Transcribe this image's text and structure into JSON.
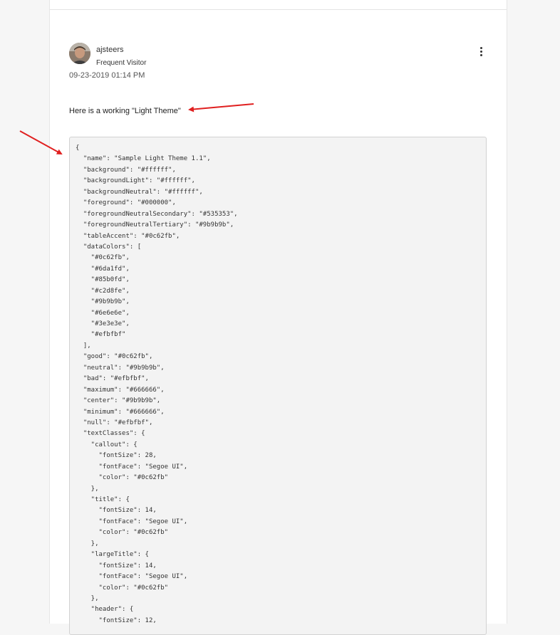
{
  "post": {
    "author": "ajsteers",
    "rank": "Frequent Visitor",
    "date": "09-23-2019 01:14 PM",
    "body_text": "Here is a working \"Light Theme\"",
    "menu_icon": "more-vertical-icon",
    "avatar_icon": "user-photo"
  },
  "annotation_color": "#e02020",
  "code_lines": [
    "{",
    "  \"name\": \"Sample Light Theme 1.1\",",
    "  \"background\": \"#ffffff\",",
    "  \"backgroundLight\": \"#ffffff\",",
    "  \"backgroundNeutral\": \"#ffffff\",",
    "  \"foreground\": \"#000000\",",
    "  \"foregroundNeutralSecondary\": \"#535353\",",
    "  \"foregroundNeutralTertiary\": \"#9b9b9b\",",
    "  \"tableAccent\": \"#0c62fb\",",
    "  \"dataColors\": [",
    "    \"#0c62fb\",",
    "    \"#6da1fd\",",
    "    \"#85b0fd\",",
    "    \"#c2d8fe\",",
    "    \"#9b9b9b\",",
    "    \"#6e6e6e\",",
    "    \"#3e3e3e\",",
    "    \"#efbfbf\"",
    "  ],",
    "  \"good\": \"#0c62fb\",",
    "  \"neutral\": \"#9b9b9b\",",
    "  \"bad\": \"#efbfbf\",",
    "  \"maximum\": \"#666666\",",
    "  \"center\": \"#9b9b9b\",",
    "  \"minimum\": \"#666666\",",
    "  \"null\": \"#efbfbf\",",
    "  \"textClasses\": {",
    "    \"callout\": {",
    "      \"fontSize\": 28,",
    "      \"fontFace\": \"Segoe UI\",",
    "      \"color\": \"#0c62fb\"",
    "    },",
    "    \"title\": {",
    "      \"fontSize\": 14,",
    "      \"fontFace\": \"Segoe UI\",",
    "      \"color\": \"#0c62fb\"",
    "    },",
    "    \"largeTitle\": {",
    "      \"fontSize\": 14,",
    "      \"fontFace\": \"Segoe UI\",",
    "      \"color\": \"#0c62fb\"",
    "    },",
    "    \"header\": {",
    "      \"fontSize\": 12,"
  ]
}
